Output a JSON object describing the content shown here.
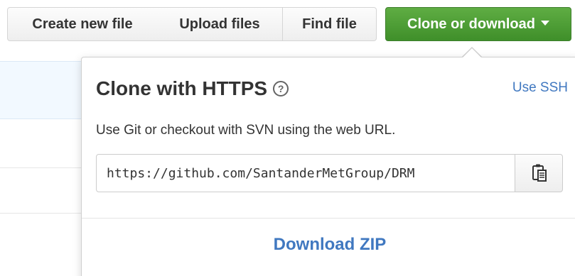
{
  "toolbar": {
    "create_new_file": "Create new file",
    "upload_files": "Upload files",
    "find_file": "Find file",
    "clone_or_download": "Clone or download"
  },
  "clone_panel": {
    "title": "Clone with HTTPS",
    "help_icon": "question-circle-icon",
    "use_ssh": "Use SSH",
    "description": "Use Git or checkout with SVN using the web URL.",
    "url_value": "https://github.com/SantanderMetGroup/DRM",
    "copy_icon": "clipboard-icon",
    "download_zip": "Download ZIP"
  },
  "colors": {
    "clone_button_green": "#4c9e35",
    "link_blue": "#4078c0",
    "text_dark": "#333333",
    "highlight_row": "#f2f9ff"
  }
}
